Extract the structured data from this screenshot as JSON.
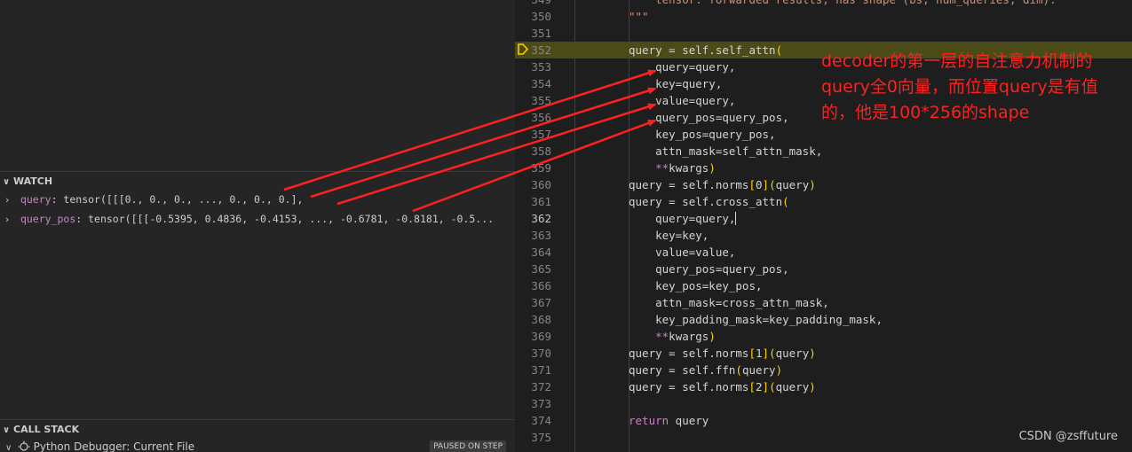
{
  "watch": {
    "header": "WATCH",
    "items": [
      {
        "name": "query",
        "value": "tensor([[[0., 0., 0.,  ..., 0., 0., 0.],"
      },
      {
        "name": "query_pos",
        "value": "tensor([[[-0.5395,  0.4836, -0.4153,  ..., -0.6781, -0.8181, -0.5..."
      }
    ]
  },
  "call_stack": {
    "header": "CALL STACK",
    "session": "Python Debugger: Current File",
    "status": "PAUSED ON STEP"
  },
  "editor": {
    "current_line": 352,
    "cursor_line": 362,
    "lines": [
      {
        "n": "349",
        "text": "    tensor: forwarded results, has shape (bs, num_queries, dim)."
      },
      {
        "n": "350",
        "text": "\"\"\""
      },
      {
        "n": "351",
        "text": ""
      },
      {
        "n": "352",
        "text": "query = self.self_attn("
      },
      {
        "n": "353",
        "text": "    query=query,"
      },
      {
        "n": "354",
        "text": "    key=query,"
      },
      {
        "n": "355",
        "text": "    value=query,"
      },
      {
        "n": "356",
        "text": "    query_pos=query_pos,"
      },
      {
        "n": "357",
        "text": "    key_pos=query_pos,"
      },
      {
        "n": "358",
        "text": "    attn_mask=self_attn_mask,"
      },
      {
        "n": "359",
        "text": "    **kwargs)"
      },
      {
        "n": "360",
        "text": "query = self.norms[0](query)"
      },
      {
        "n": "361",
        "text": "query = self.cross_attn("
      },
      {
        "n": "362",
        "text": "    query=query,"
      },
      {
        "n": "363",
        "text": "    key=key,"
      },
      {
        "n": "364",
        "text": "    value=value,"
      },
      {
        "n": "365",
        "text": "    query_pos=query_pos,"
      },
      {
        "n": "366",
        "text": "    key_pos=key_pos,"
      },
      {
        "n": "367",
        "text": "    attn_mask=cross_attn_mask,"
      },
      {
        "n": "368",
        "text": "    key_padding_mask=key_padding_mask,"
      },
      {
        "n": "369",
        "text": "    **kwargs)"
      },
      {
        "n": "370",
        "text": "query = self.norms[1](query)"
      },
      {
        "n": "371",
        "text": "query = self.ffn(query)"
      },
      {
        "n": "372",
        "text": "query = self.norms[2](query)"
      },
      {
        "n": "373",
        "text": ""
      },
      {
        "n": "374",
        "text": "return query"
      },
      {
        "n": "375",
        "text": ""
      }
    ]
  },
  "annotation": {
    "line1": "decoder的第一层的自注意力机制的",
    "line2": "query全0向量，而位置query是有值",
    "line3": "的，他是100*256的shape"
  },
  "watermark": "CSDN @zsffuture",
  "colors": {
    "annotation": "#ff2020",
    "current_line_bg": "#4b4b18",
    "keyword": "#c586c0",
    "string": "#ce9178"
  },
  "icons": [
    "chevron-right-icon",
    "chevron-down-icon",
    "debug-session-icon",
    "breakpoint-arrow-icon"
  ]
}
